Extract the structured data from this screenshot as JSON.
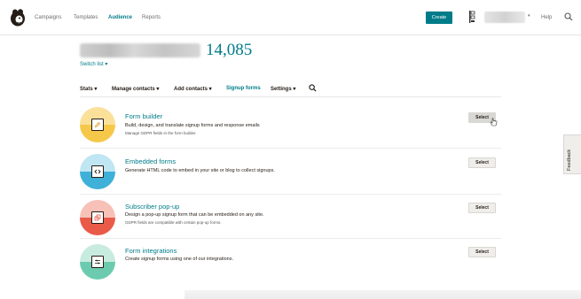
{
  "nav": {
    "links": [
      "Campaigns",
      "Templates",
      "Audience",
      "Reports"
    ],
    "active": "Audience",
    "create_label": "Create",
    "help_label": "Help",
    "account_caret": "▾"
  },
  "audience": {
    "count": "14,085",
    "switch_list": "Switch list ▾"
  },
  "subnav": {
    "stats": "Stats ▾",
    "manage_contacts": "Manage contacts ▾",
    "add_contacts": "Add contacts ▾",
    "signup_forms": "Signup forms",
    "settings": "Settings ▾"
  },
  "forms": [
    {
      "title": "Form builder",
      "description": "Build, design, and translate signup forms and response emails",
      "note": "Manage GDPR fields in the form builder.",
      "button": "Select",
      "icon": "pencil-icon",
      "color_top": "#fbe09a",
      "color_bottom": "#f6c84a"
    },
    {
      "title": "Embedded forms",
      "description": "Generate HTML code to embed in your site or blog to collect signups.",
      "note": "",
      "button": "Select",
      "icon": "code-brackets-icon",
      "color_top": "#bfe6f2",
      "color_bottom": "#3fb0d8"
    },
    {
      "title": "Subscriber pop-up",
      "description": "Design a pop-up signup form that can be embedded on any site.",
      "note": "GDPR fields are compatible with certain pop-up forms.",
      "button": "Select",
      "icon": "popup-window-icon",
      "color_top": "#f7c1b8",
      "color_bottom": "#ea5a48"
    },
    {
      "title": "Form integrations",
      "description": "Create signup forms using one of our integrations.",
      "note": "",
      "button": "Select",
      "icon": "sliders-icon",
      "color_top": "#c8ebe0",
      "color_bottom": "#6ccbae"
    }
  ],
  "feedback_label": "Feedback",
  "colors": {
    "accent": "#007c89",
    "text": "#241c15"
  }
}
